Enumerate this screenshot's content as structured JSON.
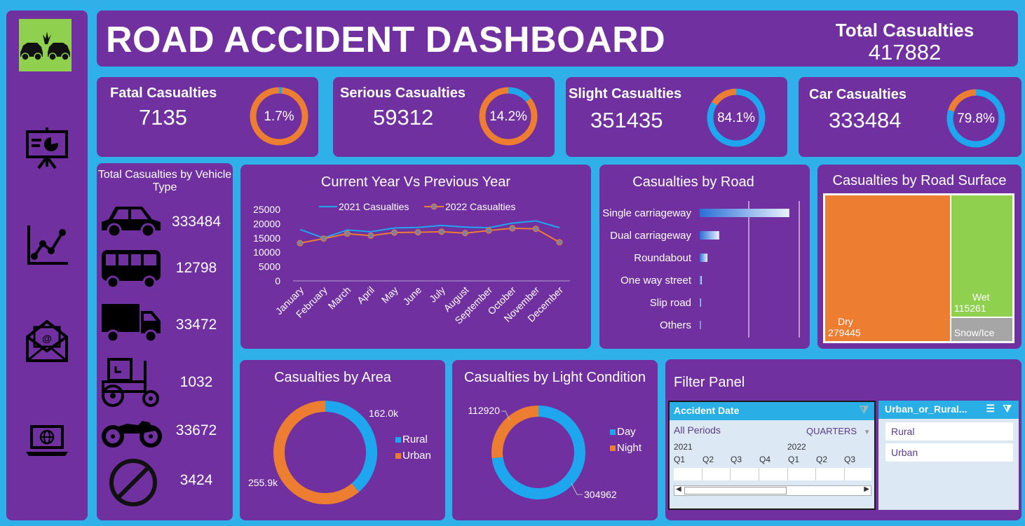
{
  "header": {
    "title": "ROAD ACCIDENT DASHBOARD",
    "total_label": "Total Casualties",
    "total_value": "417882"
  },
  "sidebar": {
    "icons": [
      "car-crash-icon",
      "presentation-icon",
      "line-chart-icon",
      "email-icon",
      "laptop-globe-icon"
    ]
  },
  "kpis": [
    {
      "label": "Fatal Casualties",
      "value": "7135",
      "percent_label": "1.7%",
      "percent": 1.7
    },
    {
      "label": "Serious Casualties",
      "value": "59312",
      "percent_label": "14.2%",
      "percent": 14.2
    },
    {
      "label": "Slight Casualties",
      "value": "351435",
      "percent_label": "84.1%",
      "percent": 84.1
    },
    {
      "label": "Car Casualties",
      "value": "333484",
      "percent_label": "79.8%",
      "percent": 79.8
    }
  ],
  "vehicles": {
    "title": "Total Casualties by Vehicle Type",
    "items": [
      {
        "icon": "car-icon",
        "value": "333484"
      },
      {
        "icon": "bus-icon",
        "value": "12798"
      },
      {
        "icon": "truck-icon",
        "value": "33472"
      },
      {
        "icon": "tractor-icon",
        "value": "1032"
      },
      {
        "icon": "motorcycle-icon",
        "value": "33672"
      },
      {
        "icon": "prohibited-icon",
        "value": "3424"
      }
    ]
  },
  "colors": {
    "panel": "#7030a0",
    "background": "#2fb0e8",
    "series_2021": "#1ea7ef",
    "series_2022": "#ed7d31",
    "green": "#8fd14f",
    "grey": "#a6a6a6"
  },
  "chart_data": [
    {
      "type": "line",
      "title": "Current Year Vs Previous Year",
      "x": [
        "January",
        "February",
        "March",
        "April",
        "May",
        "June",
        "July",
        "August",
        "September",
        "October",
        "November",
        "December"
      ],
      "series": [
        {
          "name": "2021 Casualties",
          "values": [
            18000,
            15000,
            17800,
            17200,
            18500,
            18700,
            19400,
            18800,
            18600,
            20200,
            21000,
            18600
          ]
        },
        {
          "name": "2022 Casualties",
          "values": [
            13200,
            14800,
            16500,
            15800,
            16900,
            17000,
            17200,
            16700,
            17600,
            18400,
            18200,
            13500
          ]
        }
      ],
      "yticks": [
        0,
        5000,
        10000,
        15000,
        20000,
        25000
      ],
      "ylim": [
        0,
        25000
      ],
      "legend": "top"
    },
    {
      "type": "bar",
      "title": "Casualties by Road",
      "categories": [
        "Single carriageway",
        "Dual carriageway",
        "Roundabout",
        "One way street",
        "Slip road",
        "Others"
      ],
      "values": [
        309700,
        67400,
        26800,
        7300,
        4500,
        2100
      ],
      "xlim": [
        0,
        400000
      ]
    },
    {
      "type": "heatmap",
      "title": "Casualties by Road Surface",
      "items": [
        {
          "name": "Dry",
          "value": "279445"
        },
        {
          "name": "Wet",
          "value": "115261"
        },
        {
          "name": "Snow/Ice",
          "value": ""
        }
      ],
      "values": [
        279445,
        115261,
        23176
      ]
    },
    {
      "type": "pie",
      "title": "Casualties by Area",
      "labels": [
        "Rural",
        "Urban"
      ],
      "values": [
        162.0,
        255.9
      ],
      "value_labels": [
        "162.0k",
        "255.9k"
      ],
      "legend": "right"
    },
    {
      "type": "pie",
      "title": "Casualties by Light Condition",
      "labels": [
        "Day",
        "Night"
      ],
      "values": [
        304962,
        112920
      ],
      "value_labels": [
        "304962",
        "112920"
      ],
      "legend": "right"
    }
  ],
  "filter": {
    "title": "Filter Panel",
    "date_slicer": {
      "title": "Accident Date",
      "all_periods": "All Periods",
      "granularity": "QUARTERS",
      "years": [
        "2021",
        "2022"
      ],
      "quarters": [
        "Q1",
        "Q2",
        "Q3",
        "Q4",
        "Q1",
        "Q2",
        "Q3"
      ]
    },
    "urban_slicer": {
      "title": "Urban_or_Rural...",
      "items": [
        "Rural",
        "Urban"
      ]
    }
  }
}
